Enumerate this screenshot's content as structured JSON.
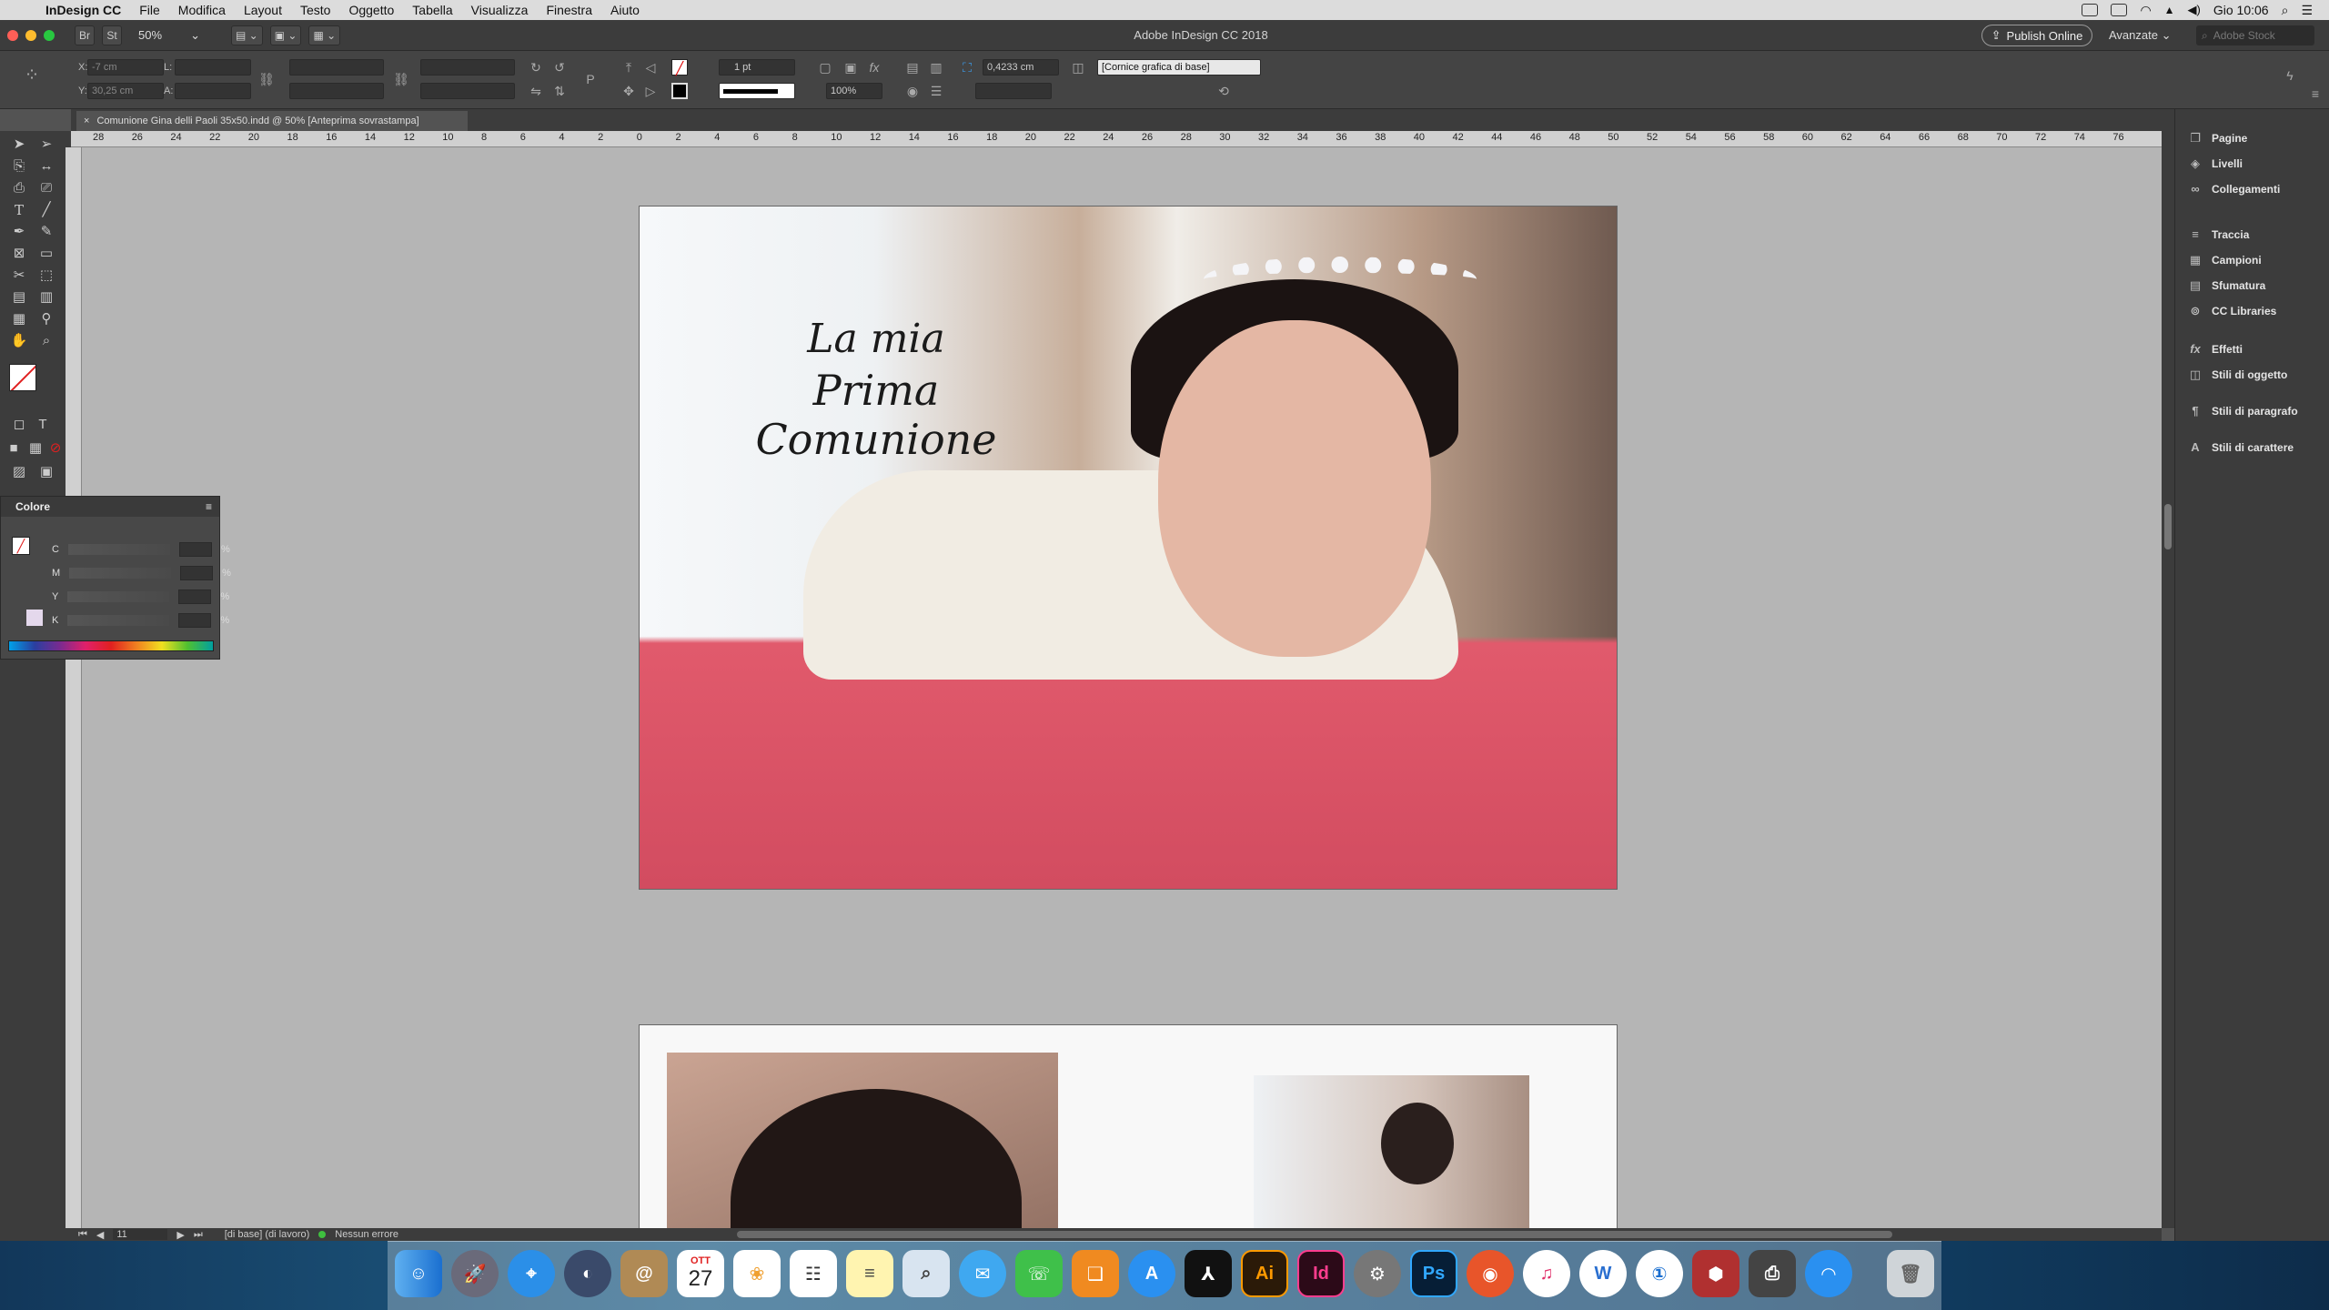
{
  "menubar": {
    "apple": "",
    "items": [
      "InDesign CC",
      "File",
      "Modifica",
      "Layout",
      "Testo",
      "Oggetto",
      "Tabella",
      "Visualizza",
      "Finestra",
      "Aiuto"
    ],
    "clock": "Gio 10:06"
  },
  "app": {
    "zoom": "50%",
    "window_title": "Adobe InDesign CC 2018",
    "publish_label": "Publish Online",
    "workspace_label": "Avanzate",
    "stock_placeholder": "Adobe Stock",
    "traffic_colors": [
      "#ff5f57",
      "#febc2e",
      "#28c840"
    ]
  },
  "control": {
    "x_label": "X:",
    "x_value": "-7 cm",
    "y_label": "Y:",
    "y_value": "30,25 cm",
    "l_label": "L:",
    "a_label": "A:",
    "stroke_weight": "1 pt",
    "measure_value": "0,4233 cm",
    "opacity_value": "100%",
    "object_style": "[Cornice grafica di base]"
  },
  "document": {
    "tab_label": "Comunione Gina delli Paoli 35x50.indd @ 50% [Anteprima sovrastampa]",
    "close_glyph": "×",
    "title_line1": "La mia",
    "title_line2": "Prima Comunione"
  },
  "ruler": {
    "ticks": [
      "28",
      "26",
      "24",
      "22",
      "20",
      "18",
      "16",
      "14",
      "12",
      "10",
      "8",
      "6",
      "4",
      "2",
      "0",
      "2",
      "4",
      "6",
      "8",
      "10",
      "12",
      "14",
      "16",
      "18",
      "20",
      "22",
      "24",
      "26",
      "28",
      "30",
      "32",
      "34",
      "36",
      "38",
      "40",
      "42",
      "44",
      "46",
      "48",
      "50",
      "52",
      "54",
      "56",
      "58",
      "60",
      "62",
      "64",
      "66",
      "68",
      "70",
      "72",
      "74",
      "76"
    ]
  },
  "panels": {
    "group1": [
      "Pagine",
      "Livelli",
      "Collegamenti"
    ],
    "group2": [
      "Traccia",
      "Campioni",
      "Sfumatura",
      "CC Libraries"
    ],
    "group3": [
      "Effetti",
      "Stili di oggetto"
    ],
    "group4": [
      "Stili di paragrafo"
    ],
    "group5": [
      "Stili di carattere"
    ]
  },
  "color_panel": {
    "title": "Colore",
    "channels": [
      "C",
      "M",
      "Y",
      "K"
    ],
    "unit": "%"
  },
  "status": {
    "page": "11",
    "master": "[di base] (di lavoro)",
    "preflight": "Nessun errore"
  },
  "dock": {
    "calendar_month": "OTT",
    "calendar_day": "27",
    "ai_label": "Ai",
    "id_label": "Id",
    "ps_label": "Ps"
  }
}
